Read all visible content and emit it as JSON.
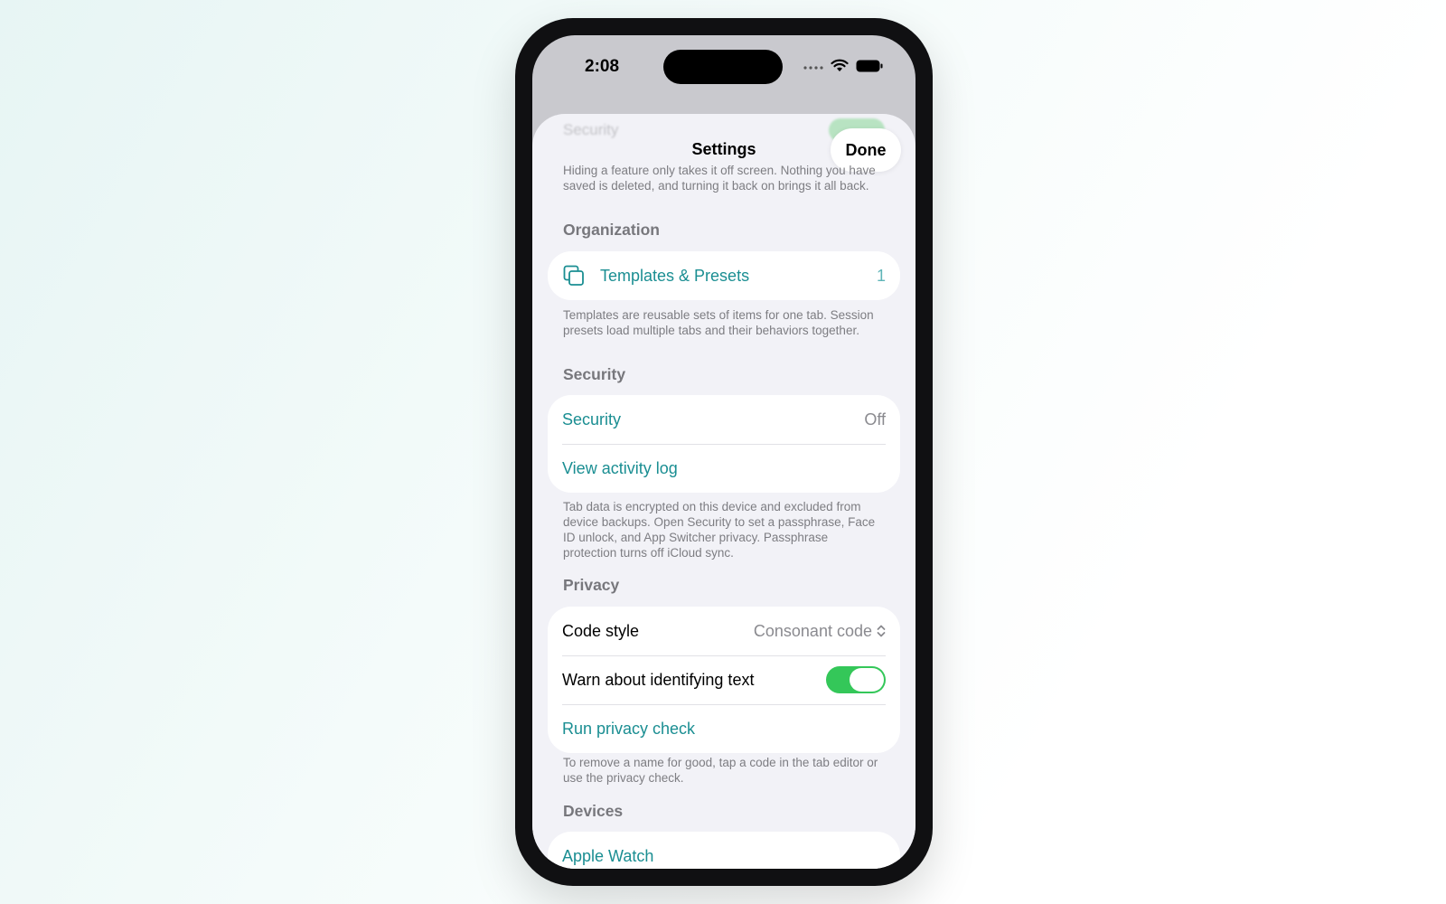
{
  "status": {
    "time": "2:08"
  },
  "nav": {
    "title": "Settings",
    "done_label": "Done"
  },
  "ghost": {
    "row_label": "Security"
  },
  "intro_footer": "Hiding a feature only takes it off screen. Nothing you have saved is deleted, and turning it back on brings it all back.",
  "organization": {
    "header": "Organization",
    "templates": {
      "label": "Templates & Presets",
      "count": "1",
      "icon": "copy-icon"
    },
    "footer": "Templates are reusable sets of items for one tab. Session presets load multiple tabs and their behaviors together."
  },
  "security": {
    "header": "Security",
    "security_row": {
      "label": "Security",
      "value": "Off"
    },
    "activity_row": {
      "label": "View activity log"
    },
    "footer": "Tab data is encrypted on this device and excluded from device backups. Open Security to set a passphrase, Face ID unlock, and App Switcher privacy. Passphrase protection turns off iCloud sync."
  },
  "privacy": {
    "header": "Privacy",
    "code_style": {
      "label": "Code style",
      "value": "Consonant code",
      "icon": "chevron-updown-icon"
    },
    "warn": {
      "label": "Warn about identifying text",
      "enabled": true
    },
    "run_check": {
      "label": "Run privacy check"
    },
    "footer": "To remove a name for good, tap a code in the tab editor or use the privacy check."
  },
  "devices": {
    "header": "Devices",
    "apple_watch": {
      "label": "Apple Watch"
    }
  },
  "colors": {
    "accent": "#1a8e92",
    "toggle_on": "#34c759",
    "background": "#f2f2f7"
  }
}
